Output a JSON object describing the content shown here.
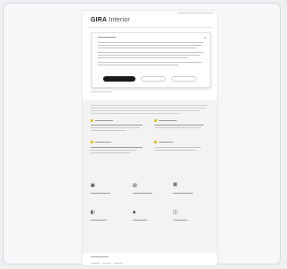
{
  "brand": {
    "bold": "GIRA",
    "light": "Interior"
  },
  "consent": {
    "accept_label": "",
    "decline_label": "",
    "settings_label": ""
  }
}
